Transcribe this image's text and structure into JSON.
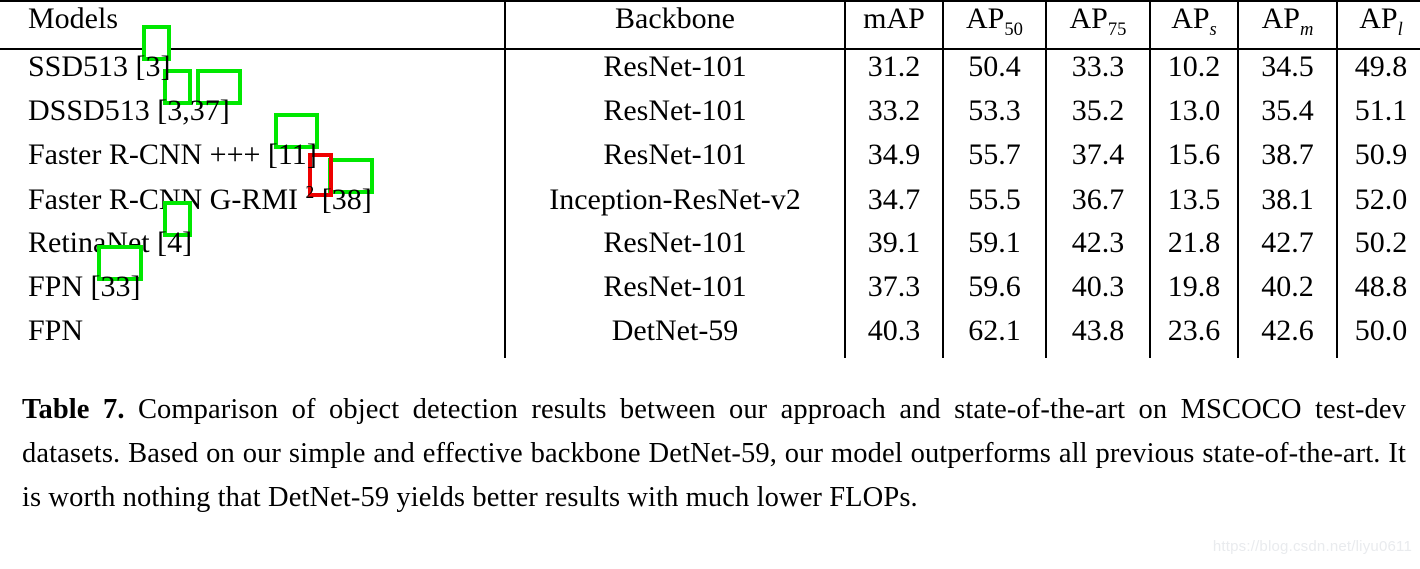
{
  "table": {
    "name": "Table 7",
    "headers": {
      "models": "Models",
      "backbone": "Backbone",
      "mAP": "mAP",
      "AP50": {
        "base": "AP",
        "sub": "50"
      },
      "AP75": {
        "base": "AP",
        "sub": "75"
      },
      "APs": {
        "base": "AP",
        "sub": "s"
      },
      "APm": {
        "base": "AP",
        "sub": "m"
      },
      "APl": {
        "base": "AP",
        "sub": "l"
      }
    },
    "rows": [
      {
        "model_name": "SSD513",
        "citations": [
          "3"
        ],
        "backbone": "ResNet-101",
        "mAP": "31.2",
        "AP50": "50.4",
        "AP75": "33.3",
        "APs": "10.2",
        "APm": "34.5",
        "APl": "49.8"
      },
      {
        "model_name": "DSSD513",
        "citations": [
          "3",
          "37"
        ],
        "backbone": "ResNet-101",
        "mAP": "33.2",
        "AP50": "53.3",
        "AP75": "35.2",
        "APs": "13.0",
        "APm": "35.4",
        "APl": "51.1"
      },
      {
        "model_name": "Faster R-CNN +++",
        "citations": [
          "11"
        ],
        "backbone": "ResNet-101",
        "mAP": "34.9",
        "AP50": "55.7",
        "AP75": "37.4",
        "APs": "15.6",
        "APm": "38.7",
        "APl": "50.9"
      },
      {
        "model_name": "Faster R-CNN G-RMI",
        "footnote": "2",
        "citations": [
          "38"
        ],
        "backbone": "Inception-ResNet-v2",
        "mAP": "34.7",
        "AP50": "55.5",
        "AP75": "36.7",
        "APs": "13.5",
        "APm": "38.1",
        "APl": "52.0"
      },
      {
        "model_name": "RetinaNet",
        "citations": [
          "4"
        ],
        "backbone": "ResNet-101",
        "mAP": "39.1",
        "AP50": "59.1",
        "AP75": "42.3",
        "APs": "21.8",
        "APm": "42.7",
        "APl": "50.2"
      },
      {
        "model_name": "FPN",
        "citations": [
          "33"
        ],
        "backbone": "ResNet-101",
        "mAP": "37.3",
        "AP50": "59.6",
        "AP75": "40.3",
        "APs": "19.8",
        "APm": "40.2",
        "APl": "48.8"
      },
      {
        "model_name": "FPN",
        "citations": [],
        "backbone": "DetNet-59",
        "mAP": "40.3",
        "AP50": "62.1",
        "AP75": "43.8",
        "APs": "23.6",
        "APm": "42.6",
        "APl": "50.0"
      }
    ]
  },
  "caption": {
    "label": "Table 7.",
    "text": " Comparison of object detection results between our approach and state-of-the-art on MSCOCO test-dev datasets. Based on our simple and effective backbone DetNet-59, our model outperforms all previous state-of-the-art. It is worth nothing that DetNet-59 yields better results with much lower FLOPs."
  },
  "watermark": {
    "text": "https://blog.csdn.net/liyu0611"
  },
  "annotations": {
    "highlight_color": "#00e800",
    "footnote_box_color": "#ee0000"
  }
}
